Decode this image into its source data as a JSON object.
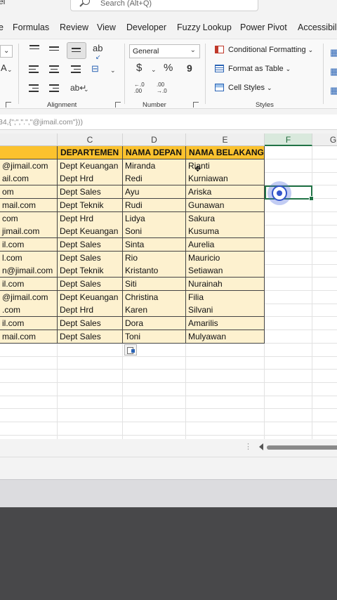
{
  "window": {
    "title_fragment": "el",
    "search_placeholder": "Search (Alt+Q)"
  },
  "menu_tabs": [
    "Formulas",
    "Review",
    "View",
    "Developer",
    "Fuzzy Lookup",
    "Power Pivot",
    "Accessibility"
  ],
  "ribbon": {
    "alignment_label": "Alignment",
    "number_label": "Number",
    "styles_label": "Styles",
    "number_format": "General",
    "currency_symbol": "$",
    "percent_symbol": "%",
    "comma_symbol": "9",
    "conditional_formatting": "Conditional Formatting",
    "format_as_table": "Format as Table",
    "cell_styles": "Cell Styles",
    "font_fragment": "A",
    "increase_decimal": "←.0 .00",
    "decrease_decimal": ".00 →.0"
  },
  "formula_bar": {
    "text": "34,{\";\",\".\",\"@jimail.com\"}))"
  },
  "sheet": {
    "columns": [
      "C",
      "D",
      "E",
      "F",
      "G"
    ],
    "selected_column": "F",
    "header": [
      "",
      "DEPARTEMEN",
      "NAMA DEPAN",
      "NAMA BELAKANG"
    ],
    "rows": [
      [
        "@jimail.com",
        "Dept Keuangan",
        "Miranda",
        "Rianti"
      ],
      [
        "ail.com",
        "Dept Hrd",
        "Redi",
        "Kurniawan"
      ],
      [
        "om",
        "Dept Sales",
        "Ayu",
        "Ariska"
      ],
      [
        "mail.com",
        "Dept Teknik",
        "Rudi",
        "Gunawan"
      ],
      [
        "com",
        "Dept Hrd",
        "Lidya",
        "Sakura"
      ],
      [
        "jimail.com",
        "Dept Keuangan",
        "Soni",
        "Kusuma"
      ],
      [
        "il.com",
        "Dept Sales",
        "Sinta",
        "Aurelia"
      ],
      [
        "l.com",
        "Dept Sales",
        "Rio",
        "Mauricio"
      ],
      [
        "n@jimail.com",
        "Dept Teknik",
        "Kristanto",
        "Setiawan"
      ],
      [
        "il.com",
        "Dept Sales",
        "Siti",
        "Nurainah"
      ],
      [
        "@jimail.com",
        "Dept Keuangan",
        "Christina",
        "Filia"
      ],
      [
        ".com",
        "Dept Hrd",
        "Karen",
        "Silvani"
      ],
      [
        "il.com",
        "Dept Sales",
        "Dora",
        "Amarilis"
      ],
      [
        "mail.com",
        "Dept Sales",
        "Toni",
        "Mulyawan"
      ]
    ]
  },
  "colors": {
    "header_fill": "#fbc22e",
    "data_fill": "#fdf1cf",
    "selection": "#217346",
    "click_indicator": "#3355cc"
  }
}
